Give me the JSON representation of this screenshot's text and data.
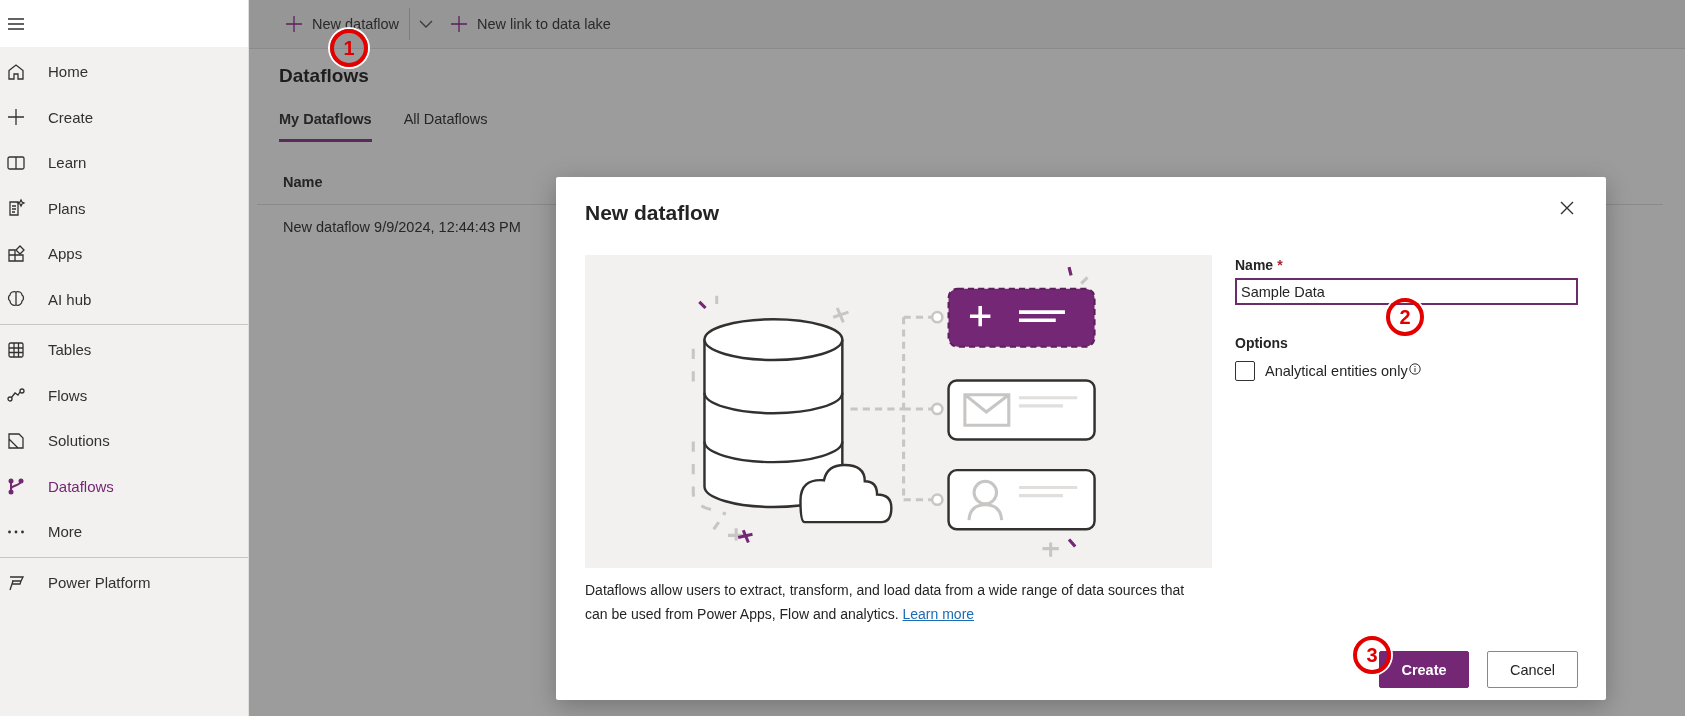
{
  "sidebar": {
    "sections": [
      {
        "items": [
          {
            "label": "Home",
            "selected": false
          },
          {
            "label": "Create",
            "selected": false
          },
          {
            "label": "Learn",
            "selected": false
          },
          {
            "label": "Plans",
            "selected": false
          },
          {
            "label": "Apps",
            "selected": false
          },
          {
            "label": "AI hub",
            "selected": false
          }
        ]
      },
      {
        "items": [
          {
            "label": "Tables",
            "selected": false
          },
          {
            "label": "Flows",
            "selected": false
          },
          {
            "label": "Solutions",
            "selected": false
          },
          {
            "label": "Dataflows",
            "selected": true
          },
          {
            "label": "More",
            "selected": false
          }
        ]
      },
      {
        "items": [
          {
            "label": "Power Platform",
            "selected": false
          }
        ]
      }
    ]
  },
  "toolbar": {
    "buttons": [
      {
        "label": "New dataflow",
        "kind": "split"
      },
      {
        "label": "New link to data lake",
        "kind": "plain"
      }
    ]
  },
  "page": {
    "title": "Dataflows",
    "tabs": [
      {
        "label": "My Dataflows",
        "selected": true
      },
      {
        "label": "All Dataflows",
        "selected": false
      }
    ],
    "table": {
      "columns": [
        "Name"
      ],
      "rows": [
        [
          "New dataflow 9/9/2024, 12:44:43 PM"
        ]
      ]
    }
  },
  "dialog": {
    "title": "New dataflow",
    "description": "Dataflows allow users to extract, transform, and load data from a wide range of data sources that can be used from Power Apps, Flow and analytics.",
    "link": "Learn more",
    "name_field": {
      "label": "Name",
      "required_mark": "*",
      "value": "Sample Data"
    },
    "options_label": "Options",
    "checkbox": {
      "label": "Analytical entities only",
      "checked": false
    },
    "buttons": [
      {
        "label": "Create",
        "kind": "primary"
      },
      {
        "label": "Cancel",
        "kind": "secondary"
      }
    ]
  },
  "annotations": [
    {
      "label": "1"
    },
    {
      "label": "2"
    },
    {
      "label": "3"
    }
  ]
}
